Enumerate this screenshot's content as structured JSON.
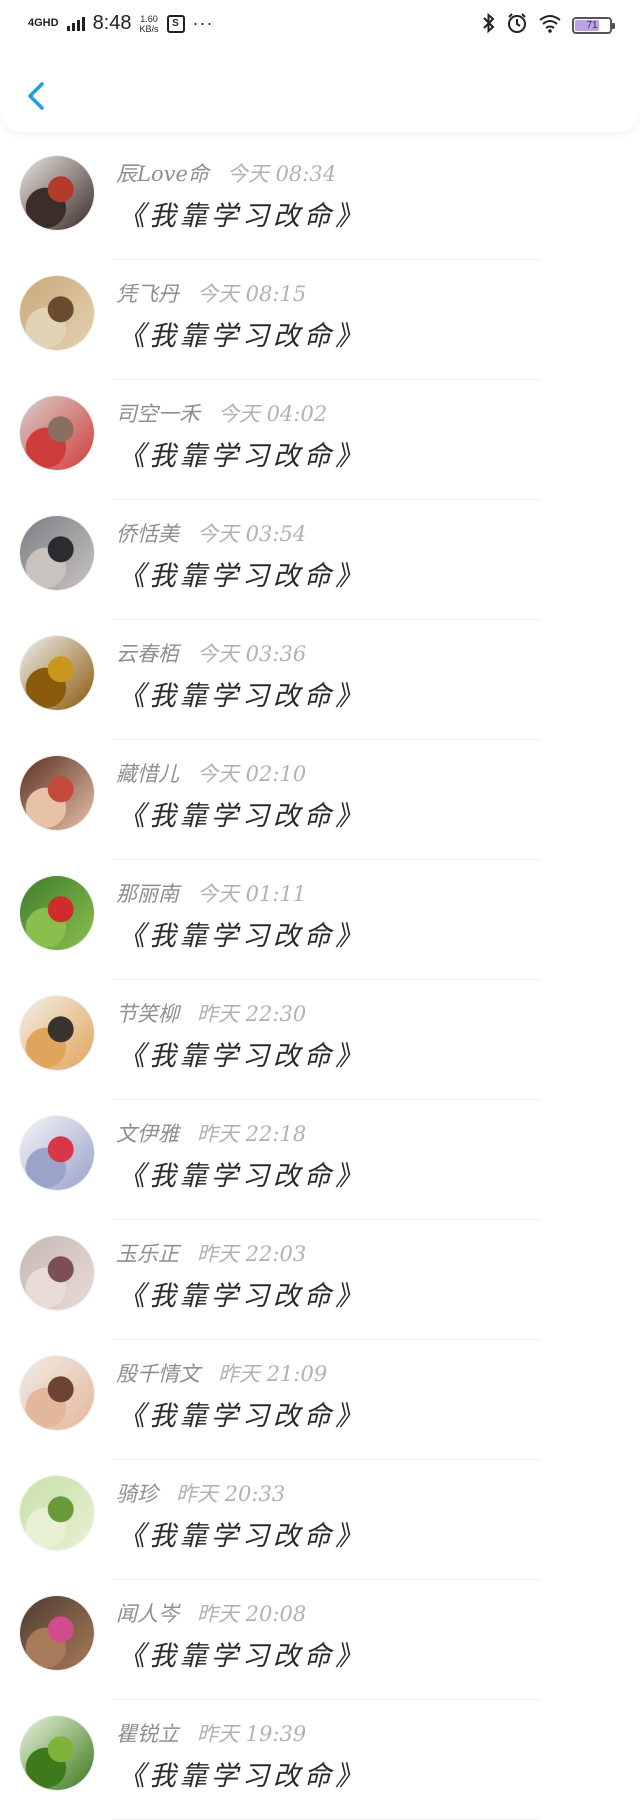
{
  "status_bar": {
    "network": "4GHD",
    "time": "8:48",
    "speed_value": "1.60",
    "speed_unit": "KB/s",
    "app_badge": "S",
    "more": "···",
    "battery": "71"
  },
  "rows": [
    {
      "name": "辰Love命",
      "time": "今天 08:34",
      "message": "《我靠学习改命》",
      "avatar_colors": [
        "#e9e3df",
        "#b43a2a",
        "#3b2d29"
      ]
    },
    {
      "name": "凭飞丹",
      "time": "今天 08:15",
      "message": "《我靠学习改命》",
      "avatar_colors": [
        "#c9a877",
        "#6b4b2f",
        "#e3d3b5"
      ]
    },
    {
      "name": "司空一禾",
      "time": "今天 04:02",
      "message": "《我靠学习改命》",
      "avatar_colors": [
        "#d8cfc8",
        "#8a6f60",
        "#cf3c3c"
      ]
    },
    {
      "name": "侨恬美",
      "time": "今天 03:54",
      "message": "《我靠学习改命》",
      "avatar_colors": [
        "#7a7f86",
        "#2b2c30",
        "#c8c3bf"
      ]
    },
    {
      "name": "云春栢",
      "time": "今天 03:36",
      "message": "《我靠学习改命》",
      "avatar_colors": [
        "#efefef",
        "#c9971c",
        "#8a5b0c"
      ]
    },
    {
      "name": "藏惜儿",
      "time": "今天 02:10",
      "message": "《我靠学习改命》",
      "avatar_colors": [
        "#5a2f22",
        "#c24a3c",
        "#e7c2a8"
      ]
    },
    {
      "name": "那丽南",
      "time": "今天 01:11",
      "message": "《我靠学习改命》",
      "avatar_colors": [
        "#3e7d2d",
        "#d12b2b",
        "#8bbf4d"
      ]
    },
    {
      "name": "节笑柳",
      "time": "昨天 22:30",
      "message": "《我靠学习改命》",
      "avatar_colors": [
        "#f3efe6",
        "#3a3430",
        "#e0a45c"
      ]
    },
    {
      "name": "文伊雅",
      "time": "昨天 22:18",
      "message": "《我靠学习改命》",
      "avatar_colors": [
        "#f4f4f8",
        "#d9364a",
        "#9aa3c9"
      ]
    },
    {
      "name": "玉乐正",
      "time": "昨天 22:03",
      "message": "《我靠学习改命》",
      "avatar_colors": [
        "#c6b7b5",
        "#7b4f55",
        "#e9dcd4"
      ]
    },
    {
      "name": "殷千情文",
      "time": "昨天 21:09",
      "message": "《我靠学习改命》",
      "avatar_colors": [
        "#f1ebe6",
        "#6b4433",
        "#e3b79a"
      ]
    },
    {
      "name": "骑珍",
      "time": "昨天 20:33",
      "message": "《我靠学习改命》",
      "avatar_colors": [
        "#c8e0a9",
        "#6a9b3a",
        "#e8f1d3"
      ]
    },
    {
      "name": "闻人岑",
      "time": "昨天 20:08",
      "message": "《我靠学习改命》",
      "avatar_colors": [
        "#4e3c31",
        "#d24c8c",
        "#a77a5a"
      ]
    },
    {
      "name": "瞿锐立",
      "time": "昨天 19:39",
      "message": "《我靠学习改命》",
      "avatar_colors": [
        "#e9f3dd",
        "#7fb33b",
        "#3d7a1c"
      ]
    }
  ],
  "battery_level": 0.71,
  "accent_color": "#1e9be9"
}
